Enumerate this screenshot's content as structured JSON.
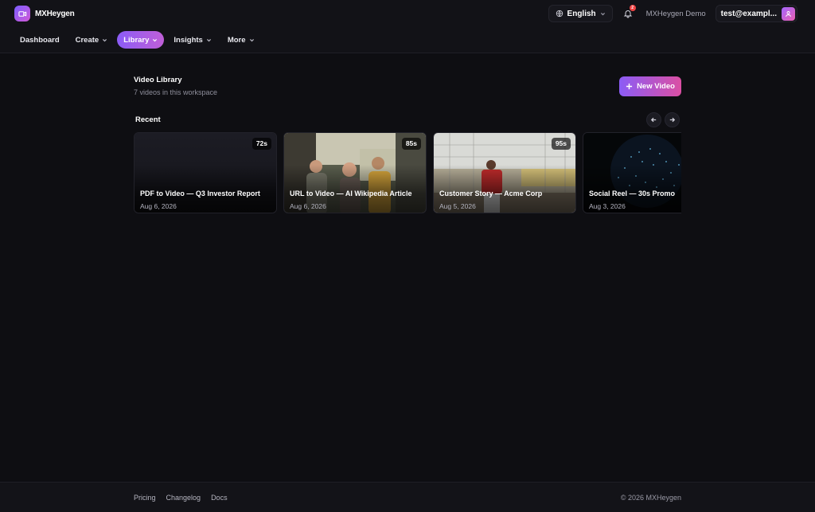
{
  "app": {
    "name": "MXHeygen"
  },
  "header": {
    "language": "English",
    "notification_count": "2",
    "workspace": "MXHeygen Demo",
    "user_email": "test@exampl..."
  },
  "nav": {
    "items": [
      {
        "label": "Dashboard",
        "dropdown": false,
        "active": false
      },
      {
        "label": "Create",
        "dropdown": true,
        "active": false
      },
      {
        "label": "Library",
        "dropdown": true,
        "active": true
      },
      {
        "label": "Insights",
        "dropdown": true,
        "active": false
      },
      {
        "label": "More",
        "dropdown": true,
        "active": false
      }
    ]
  },
  "library": {
    "title": "Video Library",
    "subtitle": "7 videos in this workspace",
    "new_button": "New Video",
    "section": "Recent"
  },
  "videos": [
    {
      "title": "PDF to Video — Q3 Investor Report",
      "date": "Aug 6, 2026",
      "duration": "72s"
    },
    {
      "title": "URL to Video — AI Wikipedia Article",
      "date": "Aug 6, 2026",
      "duration": "85s"
    },
    {
      "title": "Customer Story — Acme Corp",
      "date": "Aug 5, 2026",
      "duration": "95s"
    },
    {
      "title": "Social Reel — 30s Promo",
      "date": "Aug 3, 2026",
      "duration": ""
    }
  ],
  "footer": {
    "links": [
      "Pricing",
      "Changelog",
      "Docs"
    ],
    "copyright": "© 2026 MXHeygen"
  },
  "colors": {
    "background": "#0e0e12",
    "accent_start": "#8b5cf6",
    "accent_end": "#db4fa3"
  }
}
